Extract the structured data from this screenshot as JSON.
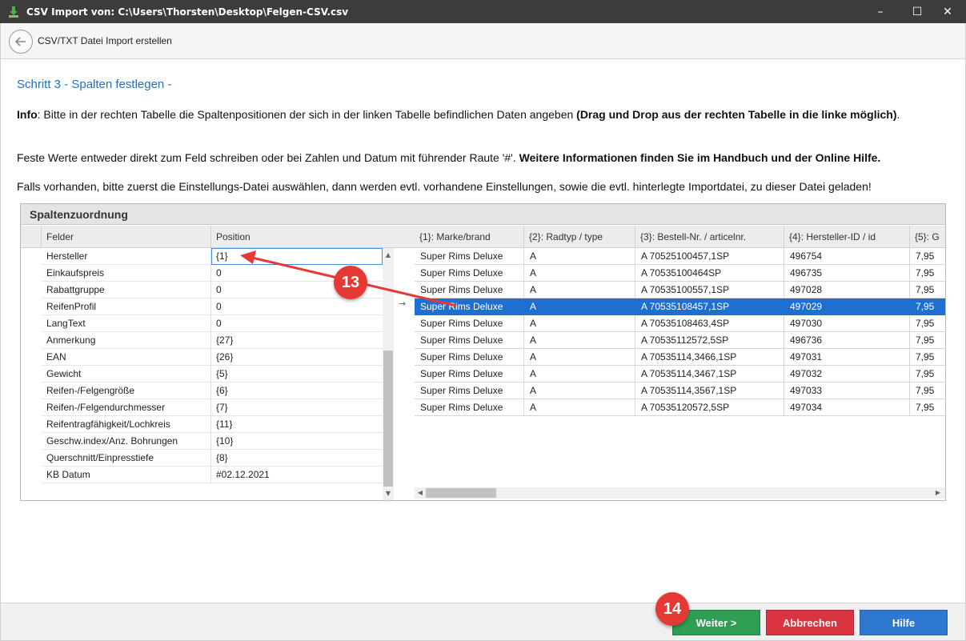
{
  "window": {
    "title": "CSV Import von: C:\\Users\\Thorsten\\Desktop\\Felgen-CSV.csv",
    "minimize": "–",
    "maximize": "☐",
    "close": "✕"
  },
  "subheader": {
    "title": "CSV/TXT Datei Import erstellen"
  },
  "step": {
    "title": "Schritt 3 - Spalten festlegen -"
  },
  "info": {
    "p1_label": "Info",
    "p1_text": ": Bitte in der rechten Tabelle die Spaltenpositionen der sich in der linken Tabelle befindlichen Daten angeben ",
    "p1_bold": "(Drag und Drop aus der rechten Tabelle in die linke möglich)",
    "p1_end": ".",
    "p2_text": "Feste Werte entweder direkt zum Feld schreiben oder bei  Zahlen und Datum mit führender Raute '#'. ",
    "p2_bold": "Weitere Informationen finden Sie im Handbuch und der Online Hilfe.",
    "p3_text": "Falls vorhanden, bitte zuerst die Einstellungs-Datei auswählen, dann werden evtl. vorhandene Einstellungen, sowie die evtl. hinterlegte Importdatei, zu dieser Datei geladen!"
  },
  "group": {
    "title": "Spaltenzuordnung"
  },
  "left_grid": {
    "headers": [
      "Felder",
      "Position"
    ],
    "rows": [
      {
        "field": "Hersteller",
        "position": "{1}"
      },
      {
        "field": "Einkaufspreis",
        "position": "0"
      },
      {
        "field": "Rabattgruppe",
        "position": "0"
      },
      {
        "field": "ReifenProfil",
        "position": "0"
      },
      {
        "field": "LangText",
        "position": "0"
      },
      {
        "field": "Anmerkung",
        "position": "{27}"
      },
      {
        "field": "EAN",
        "position": "{26}"
      },
      {
        "field": "Gewicht",
        "position": "{5}"
      },
      {
        "field": "Reifen-/Felgengröße",
        "position": "{6}"
      },
      {
        "field": "Reifen-/Felgendurchmesser",
        "position": "{7}"
      },
      {
        "field": "Reifentragfähigkeit/Lochkreis",
        "position": "{11}"
      },
      {
        "field": "Geschw.index/Anz. Bohrungen",
        "position": "{10}"
      },
      {
        "field": "Querschnitt/Einpresstiefe",
        "position": "{8}"
      },
      {
        "field": "KB Datum",
        "position": "#02.12.2021"
      }
    ]
  },
  "right_grid": {
    "row_indicator": "→",
    "headers": [
      "{1}: Marke/brand",
      "{2}: Radtyp / type",
      "{3}: Bestell-Nr. / articelnr.",
      "{4}: Hersteller-ID / id",
      "{5}: G"
    ],
    "rows": [
      [
        "Super Rims Deluxe",
        "A",
        "A 70525100457,1SP",
        "496754",
        "7,95"
      ],
      [
        "Super Rims Deluxe",
        "A",
        "A 70535100464SP",
        "496735",
        "7,95"
      ],
      [
        "Super Rims Deluxe",
        "A",
        "A 70535100557,1SP",
        "497028",
        "7,95"
      ],
      [
        "Super Rims Deluxe",
        "A",
        "A 70535108457,1SP",
        "497029",
        "7,95"
      ],
      [
        "Super Rims Deluxe",
        "A",
        "A 70535108463,4SP",
        "497030",
        "7,95"
      ],
      [
        "Super Rims Deluxe",
        "A",
        "A 70535112572,5SP",
        "496736",
        "7,95"
      ],
      [
        "Super Rims Deluxe",
        "A",
        "A 70535114,3466,1SP",
        "497031",
        "7,95"
      ],
      [
        "Super Rims Deluxe",
        "A",
        "A 70535114,3467,1SP",
        "497032",
        "7,95"
      ],
      [
        "Super Rims Deluxe",
        "A",
        "A 70535114,3567,1SP",
        "497033",
        "7,95"
      ],
      [
        "Super Rims Deluxe",
        "A",
        "A 70535120572,5SP",
        "497034",
        "7,95"
      ]
    ],
    "selected_row": 3
  },
  "annotations": {
    "badge13": "13",
    "badge14": "14"
  },
  "footer": {
    "next_label": "Weiter >",
    "cancel_label": "Abbrechen",
    "help_label": "Hilfe"
  },
  "colors": {
    "accent": "#1f6fbf",
    "selection": "#1e6fd0",
    "next": "#2e9e55",
    "cancel": "#d9343f",
    "help": "#2f78d0",
    "annotation": "#e53935"
  }
}
